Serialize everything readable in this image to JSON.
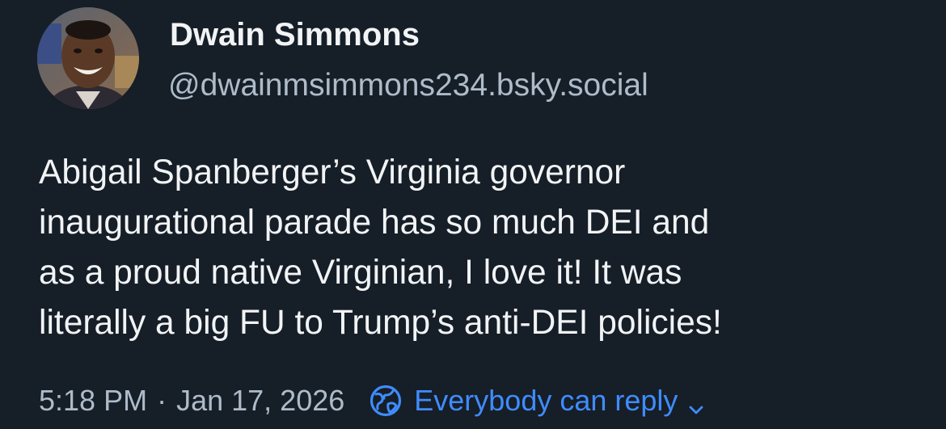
{
  "author": {
    "display_name": "Dwain Simmons",
    "handle": "@dwainmsimmons234.bsky.social",
    "avatar_icon": "profile-photo"
  },
  "post": {
    "text_lines": [
      "Abigail Spanberger’s Virginia governor",
      "inaugurational parade has so much DEI and",
      "as a proud native Virginian, I love it! It was",
      "literally a big FU to Trump’s anti-DEI policies!"
    ]
  },
  "meta": {
    "time": "5:18 PM",
    "separator": "·",
    "date": "Jan 17, 2026",
    "reply_setting_label": "Everybody can reply",
    "reply_setting_icon": "globe-icon",
    "reply_setting_chevron": "chevron-down-icon"
  },
  "colors": {
    "background": "#161e27",
    "primary_text": "#f1f3f5",
    "secondary_text": "#aebbc9",
    "accent": "#3f8cff"
  }
}
